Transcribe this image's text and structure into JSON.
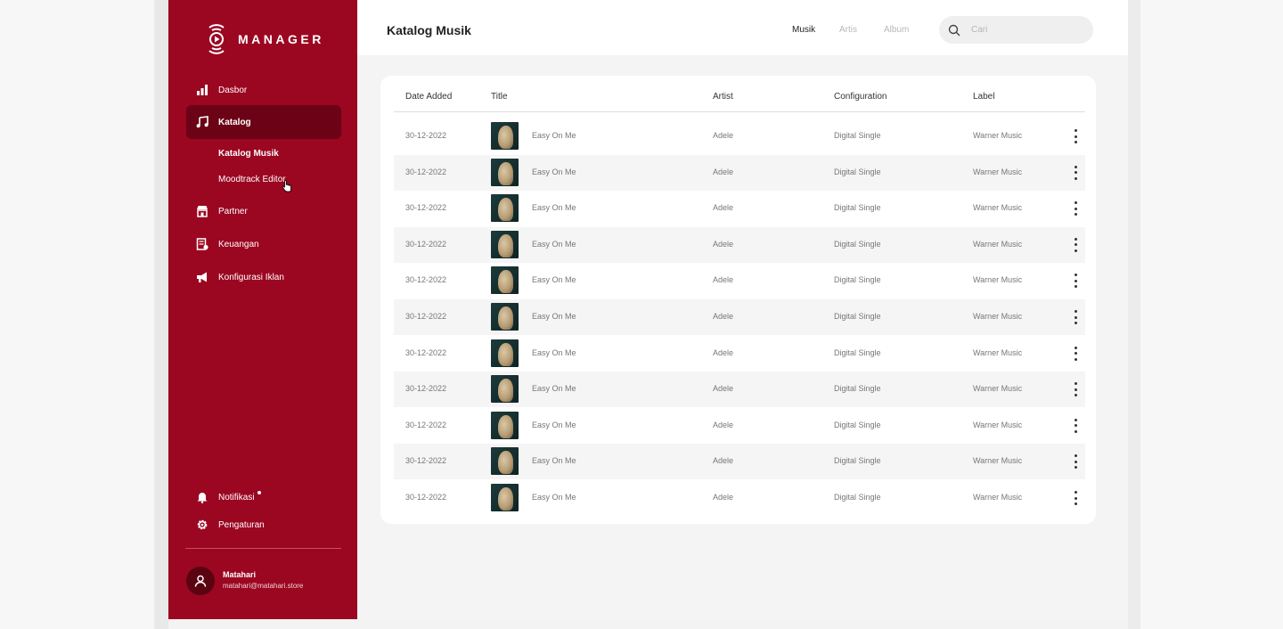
{
  "app": {
    "name": "MANAGER"
  },
  "sidebar": {
    "items": [
      {
        "label": "Dasbor",
        "icon": "bar-chart-icon"
      },
      {
        "label": "Katalog",
        "icon": "music-note-icon"
      },
      {
        "label": "Partner",
        "icon": "store-icon"
      },
      {
        "label": "Keuangan",
        "icon": "finance-icon"
      },
      {
        "label": "Konfigurasi Iklan",
        "icon": "megaphone-icon"
      }
    ],
    "sub_items": [
      {
        "label": "Katalog Musik"
      },
      {
        "label": "Moodtrack Editor"
      }
    ],
    "bottom_items": [
      {
        "label": "Notifikasi",
        "icon": "bell-icon"
      },
      {
        "label": "Pengaturan",
        "icon": "gear-icon"
      }
    ],
    "user": {
      "name": "Matahari",
      "email": "matahari@matahari.store"
    }
  },
  "header": {
    "title": "Katalog Musik",
    "tabs": [
      {
        "label": "Musik"
      },
      {
        "label": "Artis"
      },
      {
        "label": "Album"
      }
    ],
    "search": {
      "placeholder": "Cari"
    }
  },
  "table": {
    "columns": [
      "Date Added",
      "Title",
      "Artist",
      "Configuration",
      "Label"
    ],
    "rows": [
      {
        "date": "30-12-2022",
        "title": "Easy On Me",
        "artist": "Adele",
        "configuration": "Digital Single",
        "label": "Warner Music"
      },
      {
        "date": "30-12-2022",
        "title": "Easy On Me",
        "artist": "Adele",
        "configuration": "Digital Single",
        "label": "Warner Music"
      },
      {
        "date": "30-12-2022",
        "title": "Easy On Me",
        "artist": "Adele",
        "configuration": "Digital Single",
        "label": "Warner Music"
      },
      {
        "date": "30-12-2022",
        "title": "Easy On Me",
        "artist": "Adele",
        "configuration": "Digital Single",
        "label": "Warner Music"
      },
      {
        "date": "30-12-2022",
        "title": "Easy On Me",
        "artist": "Adele",
        "configuration": "Digital Single",
        "label": "Warner Music"
      },
      {
        "date": "30-12-2022",
        "title": "Easy On Me",
        "artist": "Adele",
        "configuration": "Digital Single",
        "label": "Warner Music"
      },
      {
        "date": "30-12-2022",
        "title": "Easy On Me",
        "artist": "Adele",
        "configuration": "Digital Single",
        "label": "Warner Music"
      },
      {
        "date": "30-12-2022",
        "title": "Easy On Me",
        "artist": "Adele",
        "configuration": "Digital Single",
        "label": "Warner Music"
      },
      {
        "date": "30-12-2022",
        "title": "Easy On Me",
        "artist": "Adele",
        "configuration": "Digital Single",
        "label": "Warner Music"
      },
      {
        "date": "30-12-2022",
        "title": "Easy On Me",
        "artist": "Adele",
        "configuration": "Digital Single",
        "label": "Warner Music"
      },
      {
        "date": "30-12-2022",
        "title": "Easy On Me",
        "artist": "Adele",
        "configuration": "Digital Single",
        "label": "Warner Music"
      }
    ]
  },
  "colors": {
    "brand": "#9b0621",
    "brand_active": "#6c0215"
  }
}
